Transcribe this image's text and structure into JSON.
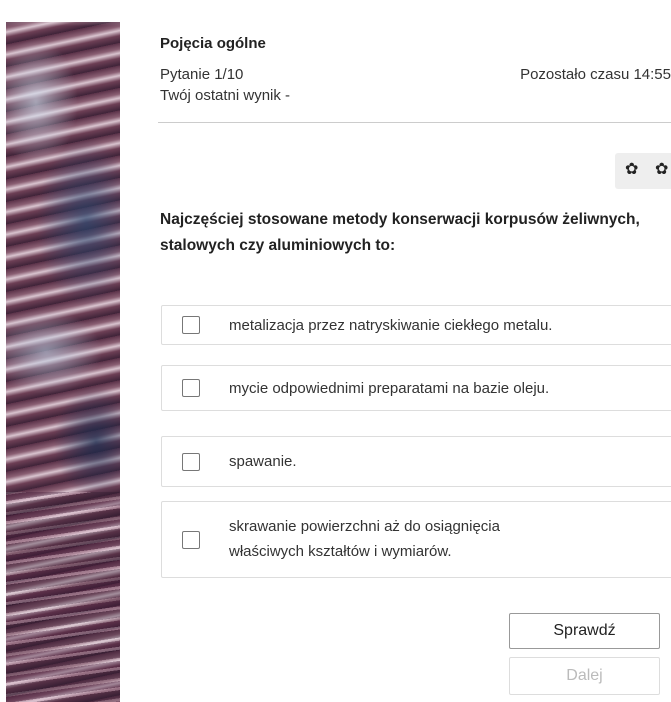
{
  "header": {
    "section_title": "Pojęcia ogólne",
    "question_counter": "Pytanie 1/10",
    "timer": "Pozostało czasu 14:55",
    "last_score": "Twój ostatni wynik -"
  },
  "toolbar": {
    "icons": [
      "gear-icon",
      "gear-icon"
    ]
  },
  "question": {
    "text": "Najczęściej stosowane metody konserwacji korpusów żeliwnych, stalowych czy aluminiowych to:"
  },
  "answers": [
    {
      "label": "metalizacja przez natryskiwanie ciekłego metalu.",
      "checked": false
    },
    {
      "label": "mycie odpowiednimi preparatami na bazie oleju.",
      "checked": false
    },
    {
      "label": "spawanie.",
      "checked": false
    },
    {
      "label_line1": "skrawanie powierzchni aż do osiągnięcia",
      "label_line2": "właściwych kształtów i wymiarów.",
      "checked": false
    }
  ],
  "buttons": {
    "check_label": "Sprawdź",
    "next_label": "Dalej",
    "next_disabled": true
  }
}
